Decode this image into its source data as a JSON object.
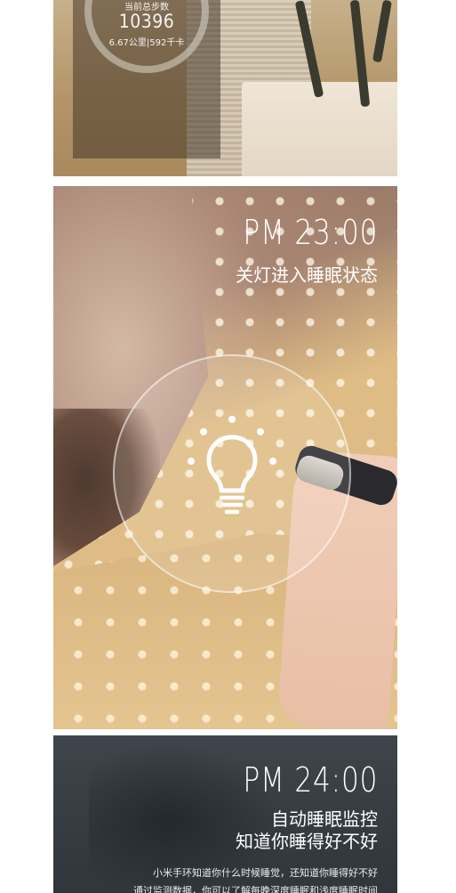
{
  "panel_steps": {
    "label": "当前总步数",
    "steps": "10396",
    "summary": "6.67公里|592千卡"
  },
  "panel_sleep_start": {
    "time": "PM 23:00",
    "caption": "关灯进入睡眠状态",
    "icon": "lightbulb-icon"
  },
  "panel_sleep_monitor": {
    "time": "PM 24:00",
    "headline_line1": "自动睡眠监控",
    "headline_line2": "知道你睡得好不好",
    "body_line1": "小米手环知道你什么时候睡觉，还知道你睡得好不好",
    "body_line2": "通过监测数据，你可以了解每晚深度睡眠和浅度睡眠时间"
  },
  "colors": {
    "text": "#ffffff",
    "panel3_bg": "#353c42",
    "blanket": "#e0bd86"
  }
}
